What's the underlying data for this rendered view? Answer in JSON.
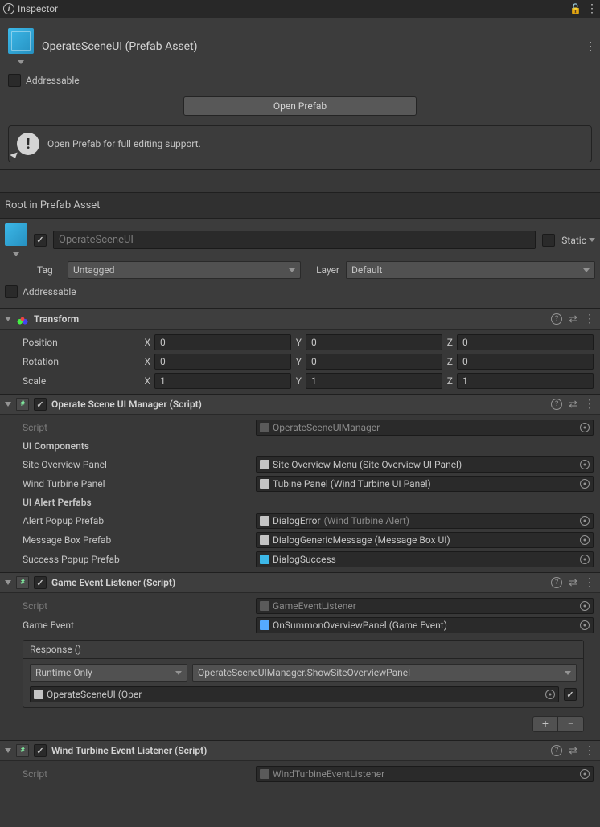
{
  "tab": {
    "title": "Inspector"
  },
  "prefab": {
    "title": "OperateSceneUI (Prefab Asset)",
    "addressable_label": "Addressable"
  },
  "openPrefab": {
    "button": "Open Prefab",
    "hint": "Open Prefab for full editing support."
  },
  "rootSection": "Root in Prefab Asset",
  "object": {
    "name": "OperateSceneUI",
    "static_label": "Static",
    "tag_label": "Tag",
    "tag_value": "Untagged",
    "layer_label": "Layer",
    "layer_value": "Default",
    "addressable_label": "Addressable"
  },
  "transform": {
    "title": "Transform",
    "position_label": "Position",
    "rotation_label": "Rotation",
    "scale_label": "Scale",
    "pos": {
      "x": "0",
      "y": "0",
      "z": "0"
    },
    "rot": {
      "x": "0",
      "y": "0",
      "z": "0"
    },
    "scale": {
      "x": "1",
      "y": "1",
      "z": "1"
    }
  },
  "uiManager": {
    "title": "Operate Scene UI Manager (Script)",
    "script_label": "Script",
    "script_value": "OperateSceneUIManager",
    "uicomp_header": "UI Components",
    "site_panel_label": "Site Overview Panel",
    "site_panel_value": "Site Overview Menu (Site Overview UI Panel)",
    "wind_panel_label": "Wind Turbine Panel",
    "wind_panel_value": "Tubine Panel (Wind Turbine UI Panel)",
    "alert_header": "UI Alert Perfabs",
    "alert_label": "Alert Popup Prefab",
    "alert_value": "DialogError",
    "alert_suffix": "(Wind Turbine Alert)",
    "msg_label": "Message Box Prefab",
    "msg_value": "DialogGenericMessage (Message Box UI)",
    "success_label": "Success Popup Prefab",
    "success_value": "DialogSuccess"
  },
  "gameEvent": {
    "title": "Game Event Listener (Script)",
    "script_label": "Script",
    "script_value": "GameEventListener",
    "event_label": "Game Event",
    "event_value": "OnSummonOverviewPanel (Game Event)",
    "response_label": "Response ()",
    "runtime": "Runtime Only",
    "method": "OperateSceneUIManager.ShowSiteOverviewPanel",
    "target": "OperateSceneUI (Oper"
  },
  "windListener": {
    "title": "Wind Turbine Event Listener (Script)",
    "script_label": "Script",
    "script_value": "WindTurbineEventListener"
  }
}
